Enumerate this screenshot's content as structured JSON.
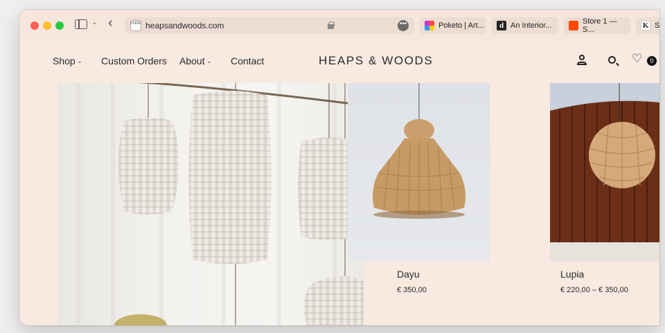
{
  "browser": {
    "url": "heapsandwoods.com",
    "favicon_text": "H&W",
    "more_label": "•••",
    "tabs": [
      {
        "label": "Poketo | Art...",
        "icon": "poketo-favicon"
      },
      {
        "label": "An Interior...",
        "icon": "d-favicon",
        "glyph": "d"
      },
      {
        "label": "Store 1 — S...",
        "icon": "store-favicon"
      },
      {
        "label": "Sl",
        "icon": "k-favicon",
        "glyph": "K"
      }
    ]
  },
  "site": {
    "logo": "HEAPS & WOODS",
    "nav": {
      "shop": "Shop",
      "custom": "Custom Orders",
      "about": "About",
      "contact": "Contact"
    },
    "wishlist_count": "0"
  },
  "products": [
    {
      "name": "Dayu",
      "price": "€ 350,00"
    },
    {
      "name": "Lupia",
      "price": "€ 220,00 – € 350,00"
    }
  ]
}
